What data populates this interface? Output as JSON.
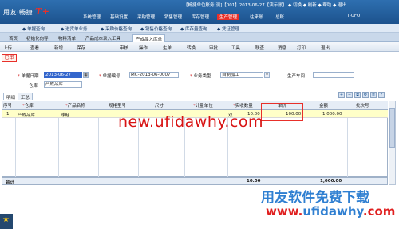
{
  "app": {
    "logo_text": "用友·畅捷",
    "logo_suffix": "T+",
    "info_line": "【畅捷单位账务[测]【001】2013-06-27【演示账】 ◆ 切换 ◆ 刷新 ◆ 帮助 ◆ 退出",
    "menus": [
      "系统管理",
      "基础设置",
      "采购管理",
      "销售管理",
      "库存管理",
      "生产管理",
      "往来账",
      "总账",
      "T-UFO"
    ],
    "active_menu": "生产管理"
  },
  "quickbar": [
    "◆ 单据查询",
    "◆ 进货单业务",
    "◆ 采购价格查询",
    "◆ 销售价格查询",
    "◆ 库存量查询",
    "◆ 凭证管理"
  ],
  "tabs": [
    "首页",
    "初始化向导",
    "物料清单",
    "产品成本录入工具",
    "产成品入库单"
  ],
  "active_tab": "产成品入库单",
  "toolbar": [
    "上传",
    "查看",
    "新增",
    "保存",
    "审核",
    "操作",
    "生单",
    "转换",
    "审批",
    "工具",
    "联查",
    "消息",
    "打印",
    "退出"
  ],
  "status_badge": "已审",
  "form": {
    "date_label": "单据日期",
    "date_value": "2013-06-27",
    "code_label": "单据编号",
    "code_value": "MC-2013-06-0007",
    "biz_label": "业务类型",
    "biz_value": "自制加工",
    "dept_label": "生产车间",
    "dept_value": "",
    "wh_label": "仓库",
    "wh_value": "产成品库"
  },
  "detail_tabs": [
    "明细",
    "汇总"
  ],
  "grid": {
    "headers": [
      "序号",
      "仓库",
      "产品名称",
      "规格型号",
      "尺寸",
      "计量单位",
      "实收数量",
      "单价",
      "金额",
      "批次号"
    ],
    "rows": [
      {
        "no": "1",
        "warehouse": "产成品库",
        "product": "球鞋",
        "spec": "",
        "size": "",
        "unit": "双",
        "qty": "10.00",
        "price": "100.00",
        "amount": "1,000.00",
        "batch": ""
      }
    ],
    "total_label": "合计",
    "total_qty": "10.00",
    "total_amount": "1,000.00"
  },
  "watermarks": {
    "site1": "new.ufidawhy.com",
    "brand": "用友软件免费下载",
    "site2_red": "www.",
    "site2_blue": "ufidawhy",
    "site2_tail": ".com"
  }
}
